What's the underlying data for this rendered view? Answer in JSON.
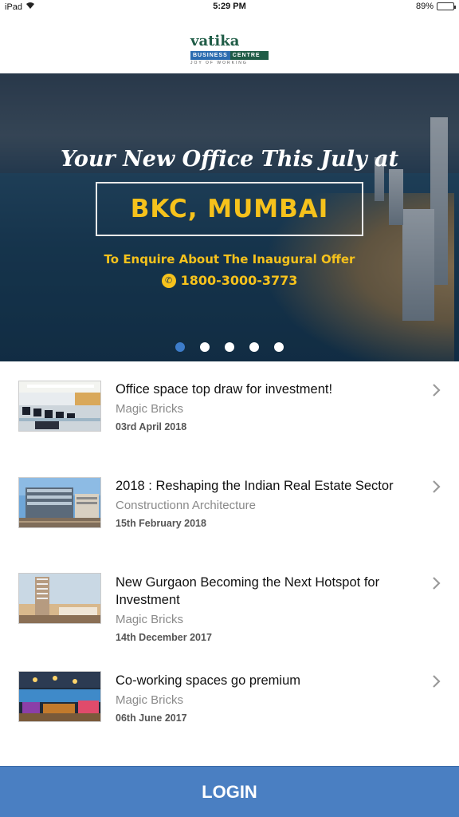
{
  "status_bar": {
    "device": "iPad",
    "time": "5:29 PM",
    "battery_text": "89%",
    "battery_level": 0.89
  },
  "logo": {
    "word": "vatika",
    "bar_left": "BUSINESS",
    "bar_right": "CENTRE",
    "tagline": "JOY OF WORKING"
  },
  "banner": {
    "headline": "Your New Office This July at",
    "city": "BKC, MUMBAI",
    "enquire": "To Enquire About The Inaugural Offer",
    "phone": "1800-3000-3773",
    "dots_total": 5,
    "active_dot": 0
  },
  "news": [
    {
      "title": "Office space top draw for investment!",
      "source": "Magic Bricks",
      "date": "03rd April 2018",
      "thumb": "office-interior"
    },
    {
      "title": "2018 : Reshaping the Indian Real Estate Sector",
      "source": "Constructionn Architecture",
      "date": "15th February 2018",
      "thumb": "building-exterior"
    },
    {
      "title": "New Gurgaon Becoming the Next Hotspot for Investment",
      "source": "Magic Bricks",
      "date": "14th December 2017",
      "thumb": "tower-skyline"
    },
    {
      "title": "Co-working spaces go premium",
      "source": "Magic Bricks",
      "date": "06th June 2017",
      "thumb": "coworking-lounge"
    }
  ],
  "login": {
    "label": "LOGIN"
  },
  "colors": {
    "accent": "#4a7fc2",
    "banner_text": "#f6c21c",
    "logo_green": "#1f5c46"
  }
}
